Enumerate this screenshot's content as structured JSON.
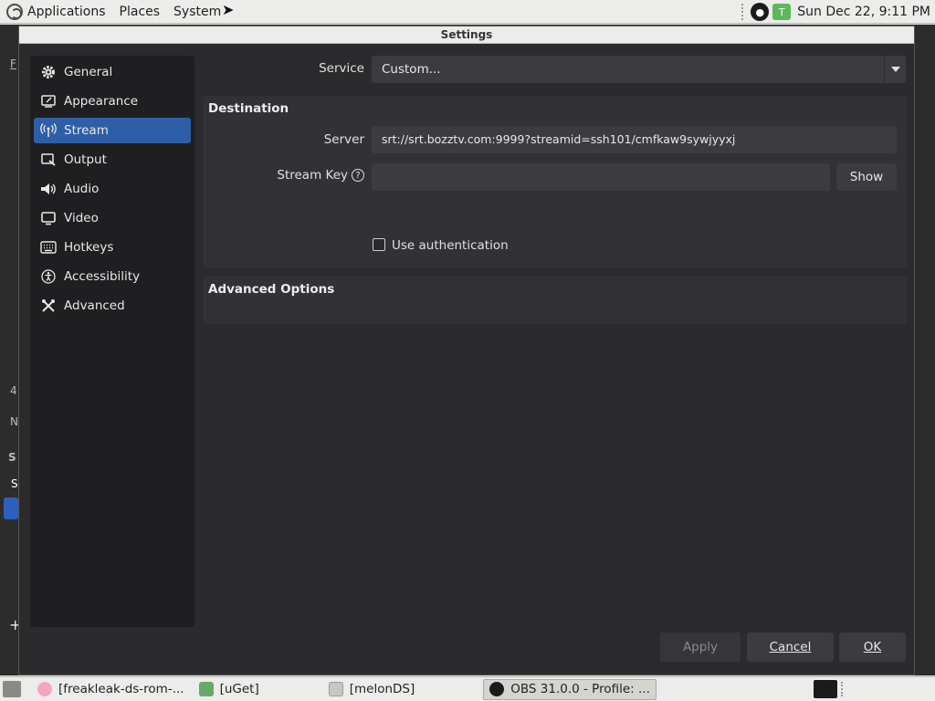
{
  "top_panel": {
    "menus": [
      "Applications",
      "Places",
      "System"
    ],
    "clock": "Sun Dec 22,  9:11 PM",
    "tray_uget_letter": "T"
  },
  "background_window": {
    "fragments": [
      "F",
      "4",
      "N",
      "S",
      "S"
    ]
  },
  "dialog": {
    "title": "Settings",
    "sidebar": {
      "items": [
        {
          "label": "General",
          "icon": "gear-icon"
        },
        {
          "label": "Appearance",
          "icon": "appearance-icon"
        },
        {
          "label": "Stream",
          "icon": "antenna-icon"
        },
        {
          "label": "Output",
          "icon": "output-icon"
        },
        {
          "label": "Audio",
          "icon": "speaker-icon"
        },
        {
          "label": "Video",
          "icon": "monitor-icon"
        },
        {
          "label": "Hotkeys",
          "icon": "keyboard-icon"
        },
        {
          "label": "Accessibility",
          "icon": "accessibility-icon"
        },
        {
          "label": "Advanced",
          "icon": "tools-icon"
        }
      ],
      "active_index": 2
    },
    "service": {
      "label": "Service",
      "value": "Custom..."
    },
    "destination": {
      "title": "Destination",
      "server_label": "Server",
      "server_value": "srt://srt.bozztv.com:9999?streamid=ssh101/cmfkaw9sywjyyxj",
      "stream_key_label": "Stream Key",
      "stream_key_value": "",
      "show_button": "Show",
      "use_auth_label": "Use authentication",
      "use_auth_checked": false
    },
    "advanced_options": {
      "title": "Advanced Options"
    },
    "footer": {
      "apply": "Apply",
      "cancel": "Cancel",
      "ok": "OK"
    }
  },
  "taskbar": {
    "tasks": [
      {
        "label": "[freakleak-ds-rom-...",
        "icon": "browser-icon"
      },
      {
        "label": "[uGet]",
        "icon": "uget-icon"
      },
      {
        "label": "[melonDS]",
        "icon": "folder-icon"
      },
      {
        "label": "OBS 31.0.0 - Profile: ...",
        "icon": "obs-icon",
        "active": true
      }
    ]
  },
  "colors": {
    "accent": "#2f5ea8",
    "dialog_bg": "#2b2b2e",
    "sidebar_bg": "#1f1f22",
    "group_bg": "#323236",
    "input_bg": "#3c3c40"
  }
}
